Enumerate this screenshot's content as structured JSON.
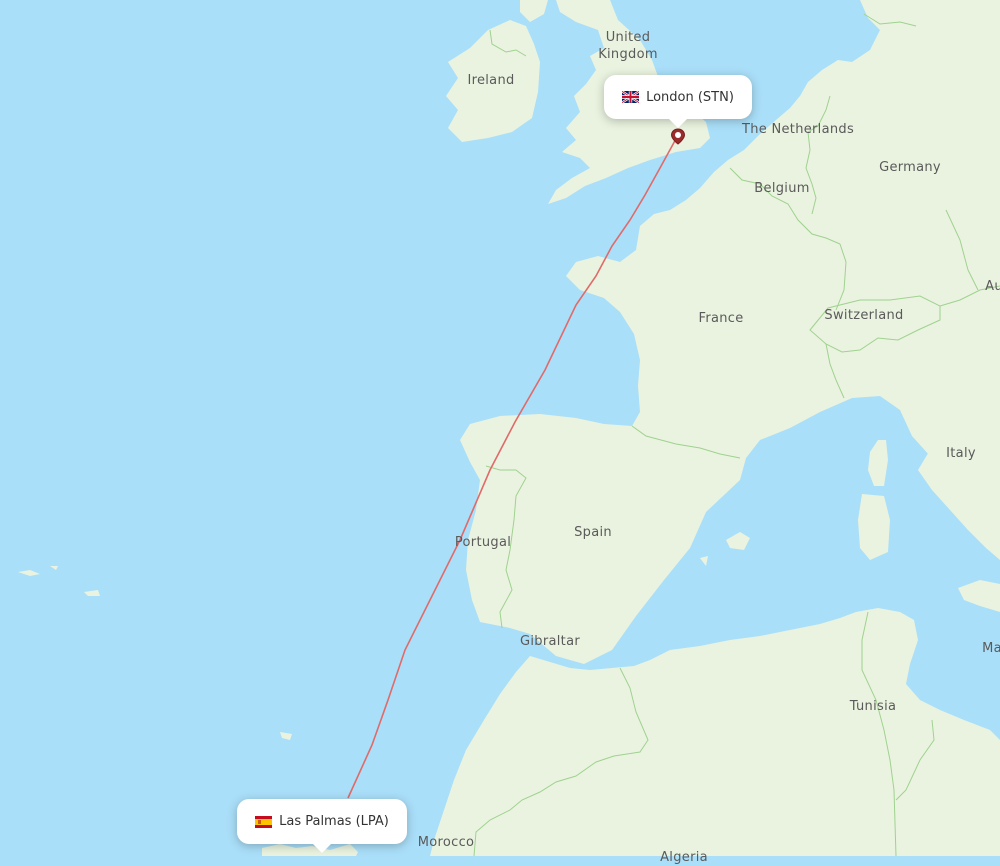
{
  "map": {
    "ocean_color": "#aadff9",
    "land_color": "#eaf3e0",
    "border_color": "#9fd28f",
    "route_color": "#e06a6a"
  },
  "origin": {
    "city": "London (STN)",
    "flag": "gb-flag-icon",
    "marker": "map-pin-icon"
  },
  "destination": {
    "city": "Las Palmas (LPA)",
    "flag": "es-flag-icon"
  },
  "country_labels": [
    {
      "id": "united-kingdom",
      "text": "United\nKingdom"
    },
    {
      "id": "ireland",
      "text": "Ireland"
    },
    {
      "id": "netherlands",
      "text": "The Netherlands"
    },
    {
      "id": "germany",
      "text": "Germany"
    },
    {
      "id": "belgium",
      "text": "Belgium"
    },
    {
      "id": "france",
      "text": "France"
    },
    {
      "id": "switzerland",
      "text": "Switzerland"
    },
    {
      "id": "austria",
      "text": "Au"
    },
    {
      "id": "italy",
      "text": "Italy"
    },
    {
      "id": "spain",
      "text": "Spain"
    },
    {
      "id": "portugal",
      "text": "Portugal"
    },
    {
      "id": "gibraltar",
      "text": "Gibraltar"
    },
    {
      "id": "tunisia",
      "text": "Tunisia"
    },
    {
      "id": "malta",
      "text": "Ma"
    },
    {
      "id": "morocco",
      "text": "Morocco"
    },
    {
      "id": "algeria",
      "text": "Algeria"
    }
  ]
}
